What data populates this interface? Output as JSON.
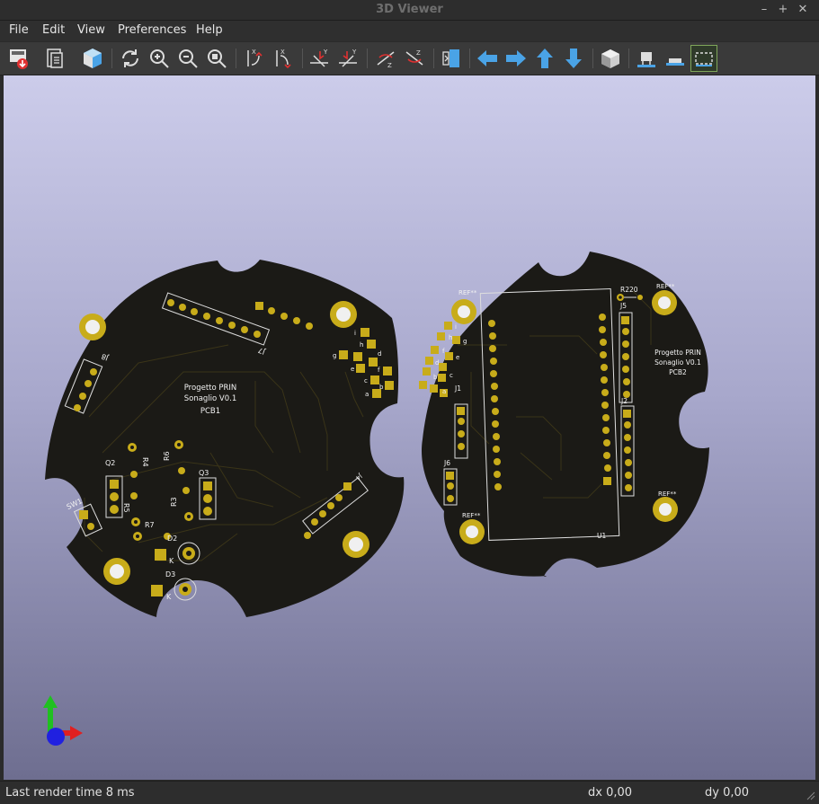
{
  "window": {
    "title": "3D Viewer",
    "controls": {
      "minimize": "–",
      "maximize": "+",
      "close": "✕"
    }
  },
  "menu": [
    {
      "label": "File"
    },
    {
      "label": "Edit"
    },
    {
      "label": "View"
    },
    {
      "label": "Preferences"
    },
    {
      "label": "Help"
    }
  ],
  "toolbar": {
    "tools": [
      {
        "name": "export-image-icon"
      },
      {
        "name": "copy-clipboard-icon"
      },
      {
        "name": "render-options-icon"
      },
      {
        "name": "reload-icon"
      },
      {
        "name": "zoom-in-icon"
      },
      {
        "name": "zoom-out-icon"
      },
      {
        "name": "zoom-fit-icon"
      },
      {
        "name": "rotate-x-cw-icon"
      },
      {
        "name": "rotate-x-ccw-icon"
      },
      {
        "name": "rotate-y-cw-icon"
      },
      {
        "name": "rotate-y-ccw-icon"
      },
      {
        "name": "rotate-z-cw-icon"
      },
      {
        "name": "rotate-z-ccw-icon"
      },
      {
        "name": "flip-board-icon"
      },
      {
        "name": "move-left-icon"
      },
      {
        "name": "move-right-icon"
      },
      {
        "name": "move-up-icon"
      },
      {
        "name": "move-down-icon"
      },
      {
        "name": "ortho-view-icon"
      },
      {
        "name": "show-footprints-icon"
      },
      {
        "name": "show-smd-icon"
      },
      {
        "name": "show-bbox-icon"
      }
    ],
    "accent": "#4aa3e6",
    "active_border": "#7fa65a"
  },
  "boards": {
    "left": {
      "text_line1": "Progetto PRIN",
      "text_line2": "Sonaglio V0.1",
      "text_line3": "PCB1",
      "refs": {
        "j8": "J8",
        "j7": "J7",
        "r4": "R4",
        "r6": "R6",
        "q2": "Q2",
        "q3": "Q3",
        "r5": "R5",
        "r3": "R3",
        "r7": "R7",
        "sw1": "SW1",
        "d2": "D2",
        "d3": "D3",
        "k1": "K",
        "k2": "K",
        "j4": "J4"
      },
      "pin_letters": [
        "i",
        "h",
        "g",
        "f",
        "e",
        "d",
        "c",
        "b",
        "a"
      ]
    },
    "right": {
      "text_line1": "Progetto PRIN",
      "text_line2": "Sonaglio V0.1",
      "text_line3": "PCB2",
      "refs": {
        "r220": "R220",
        "j5": "J5",
        "j2": "J2",
        "j1": "J1",
        "j6": "J6",
        "u1": "U1",
        "ref1": "REF**",
        "ref2": "REF**",
        "ref3": "REF**",
        "ref4": "REF**"
      },
      "pin_letters": [
        "i",
        "h",
        "g",
        "f",
        "e",
        "d",
        "c",
        "b",
        "a"
      ]
    },
    "colors": {
      "board": "#1b1a16",
      "copper": "#c8ac1a",
      "trace": "#2f2a14",
      "silk": "#f2f2f2"
    }
  },
  "axes": {
    "x_color": "#e02020",
    "y_color": "#20c020",
    "z_color": "#2020e0"
  },
  "status": {
    "render_time": "Last render time 8 ms",
    "dx": "dx 0,00",
    "dy": "dy 0,00"
  }
}
